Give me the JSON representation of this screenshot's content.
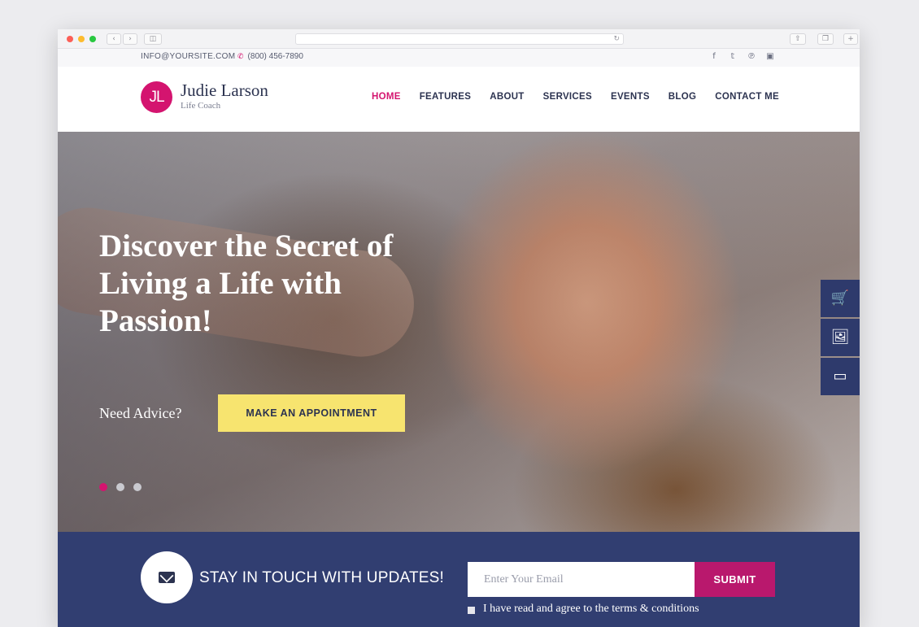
{
  "topbar": {
    "email": "INFO@YOURSITE.COM",
    "phone": "(800) 456-7890",
    "socials": [
      "facebook",
      "twitter",
      "pinterest",
      "instagram"
    ]
  },
  "brand": {
    "initials": "JL",
    "name": "Judie Larson",
    "subtitle": "Life Coach",
    "accent_color": "#d4146f"
  },
  "nav": {
    "items": [
      {
        "label": "HOME",
        "active": true
      },
      {
        "label": "FEATURES",
        "active": false
      },
      {
        "label": "ABOUT",
        "active": false
      },
      {
        "label": "SERVICES",
        "active": false
      },
      {
        "label": "EVENTS",
        "active": false
      },
      {
        "label": "BLOG",
        "active": false
      },
      {
        "label": "CONTACT ME",
        "active": false
      }
    ]
  },
  "hero": {
    "title": "Discover the Secret of Living a Life with Passion!",
    "advice": "Need Advice?",
    "button": "MAKE AN APPOINTMENT",
    "slides": 3,
    "active_slide": 1
  },
  "side_tools": [
    "cart-icon",
    "gallery-icon",
    "browser-window-icon"
  ],
  "newsletter": {
    "heading": "STAY IN TOUCH WITH UPDATES!",
    "placeholder": "Enter Your Email",
    "submit": "SUBMIT",
    "terms": "I have read and agree to the terms & conditions",
    "band_color": "#313e71"
  }
}
